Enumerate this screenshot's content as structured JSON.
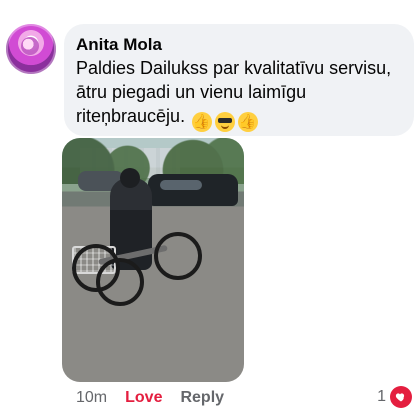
{
  "comment": {
    "author": "Anita Mola",
    "text": "Paldies Dailukss par kvalitatīvu servisu, ātru piegadi un vienu laimīgu riteņbraucēju.",
    "emojis": [
      "thumbs-up-icon",
      "smiling-face-with-sunglasses-icon",
      "thumbs-up-icon"
    ]
  },
  "meta": {
    "time": "10m",
    "love_label": "Love",
    "reply_label": "Reply"
  },
  "reactions": {
    "count": "1",
    "type": "heart-icon"
  },
  "colors": {
    "bubble_bg": "#f0f2f5",
    "love": "#e41e3f",
    "text_primary": "#050505",
    "text_secondary": "#65676b"
  }
}
